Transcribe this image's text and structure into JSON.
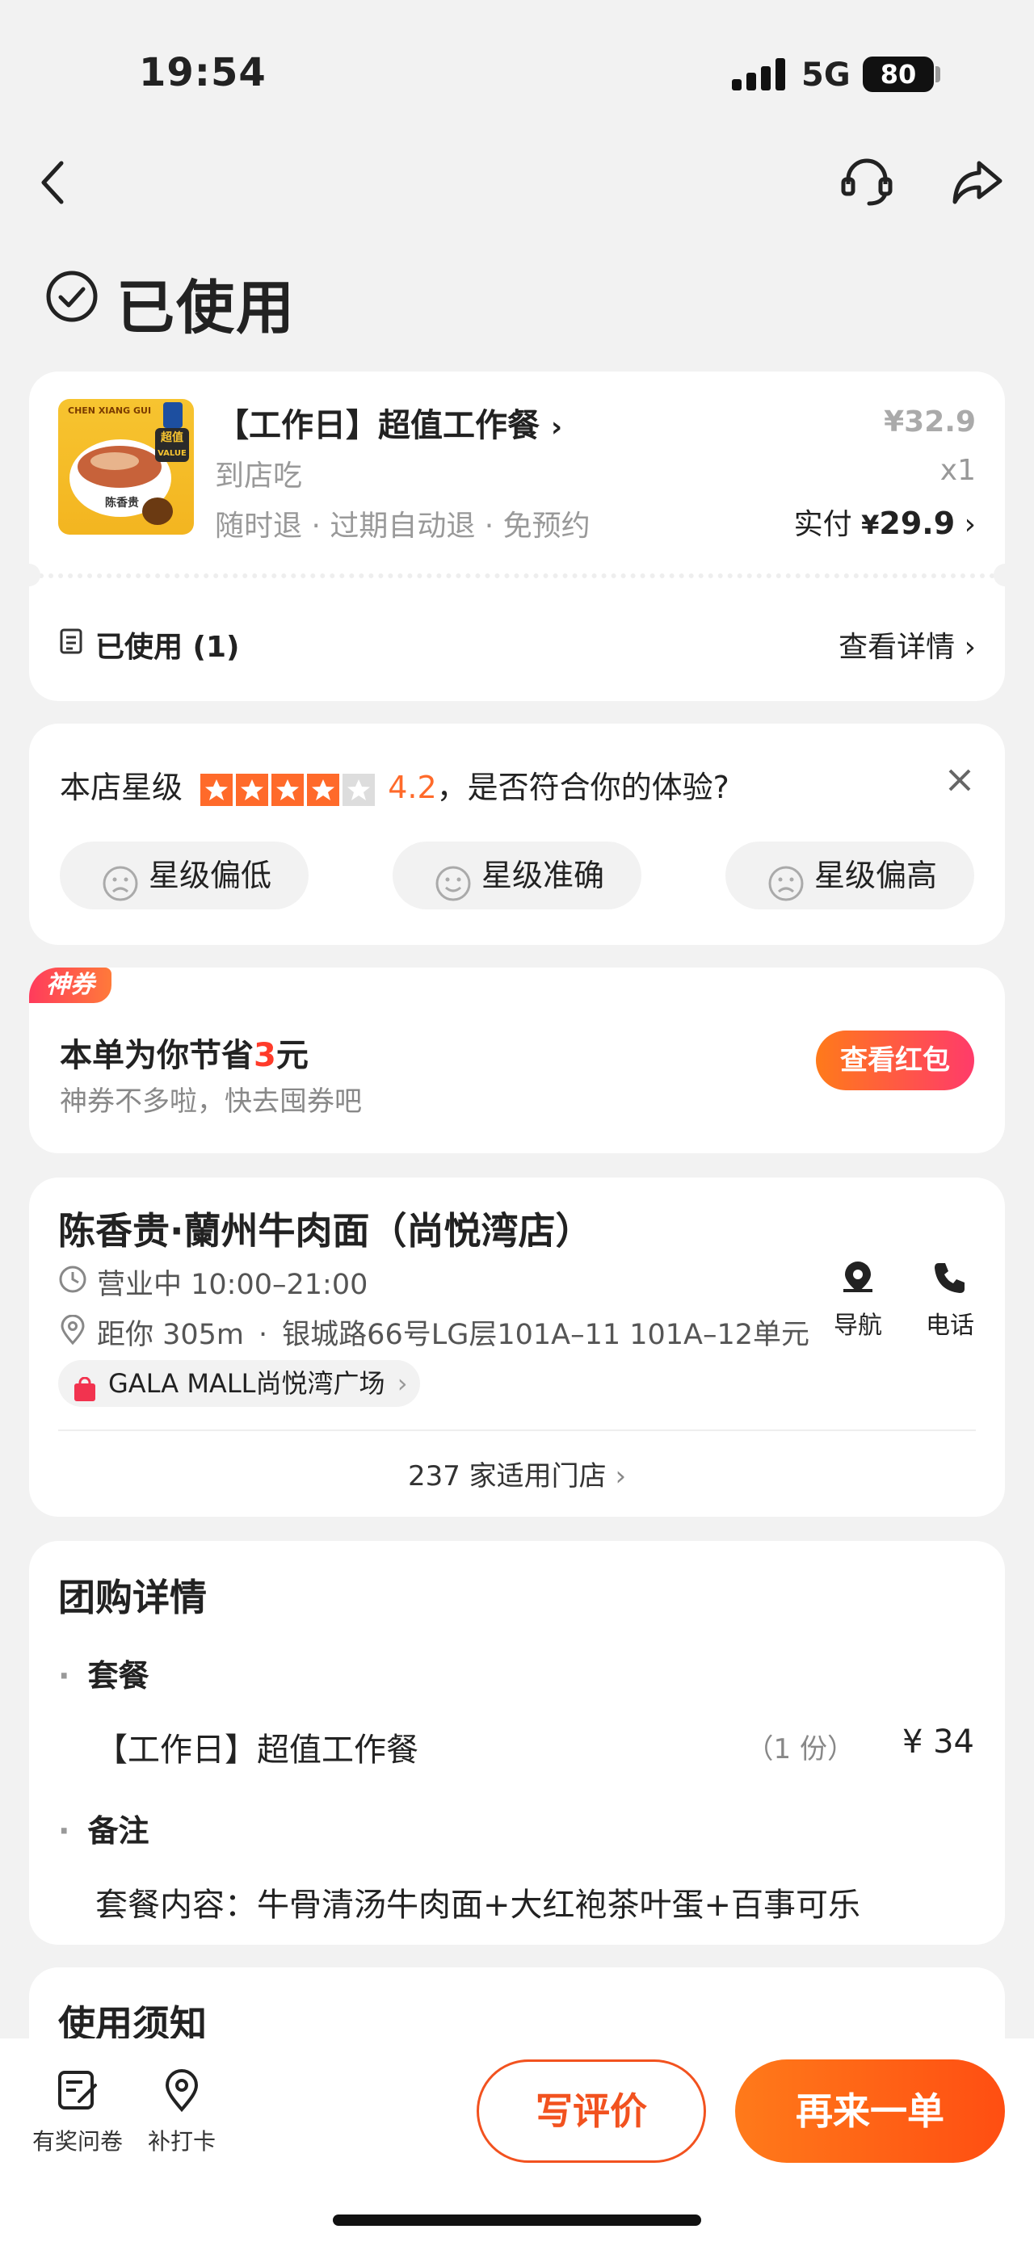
{
  "status": {
    "time": "19:54",
    "network": "5G",
    "battery": "80"
  },
  "page": {
    "title": "已使用"
  },
  "order": {
    "image_text": {
      "brand": "CHEN XIANG GUI",
      "badge": "超值",
      "badge_sub": "VALUE",
      "name": "陈香贵"
    },
    "title": "【工作日】超值工作餐",
    "type": "到店吃",
    "policies": "随时退 · 过期自动退 · 免预约",
    "original_price": "¥32.9",
    "quantity": "x1",
    "paid_label": "实付",
    "paid_currency": "¥",
    "paid_amount": "29.9",
    "used_label": "已使用 (1)",
    "detail_link": "查看详情"
  },
  "rating": {
    "label": "本店星级",
    "score": "4.2",
    "stars_filled": 4,
    "question": "，是否符合你的体验?",
    "options": [
      "星级偏低",
      "星级准确",
      "星级偏高"
    ]
  },
  "coupon": {
    "tag": "神券",
    "save_prefix": "本单为你节省",
    "save_amount": "3",
    "save_suffix": "元",
    "subtitle": "神券不多啦，快去囤券吧",
    "button": "查看红包"
  },
  "store": {
    "name": "陈香贵·蘭州牛肉面（尚悦湾店）",
    "hours": "营业中 10:00–21:00",
    "distance": "距你 305m",
    "address": "银城路66号LG层101A–11 101A–12单元",
    "mall": "GALA MALL尚悦湾广场",
    "nav_label": "导航",
    "phone_label": "电话",
    "stores_link": "237 家适用门店"
  },
  "group_detail": {
    "title": "团购详情",
    "section1": "套餐",
    "item_name": "【工作日】超值工作餐",
    "item_qty": "（1 份）",
    "item_price": "¥ 34",
    "section2": "备注",
    "note": "套餐内容：牛骨清汤牛肉面+大红袍茶叶蛋+百事可乐"
  },
  "notice": {
    "title": "使用须知"
  },
  "bottom_bar": {
    "survey": "有奖问卷",
    "checkin": "补打卡",
    "review": "写评价",
    "reorder": "再来一单"
  },
  "colors": {
    "accent": "#ff6a2a",
    "red": "#f2521f"
  }
}
